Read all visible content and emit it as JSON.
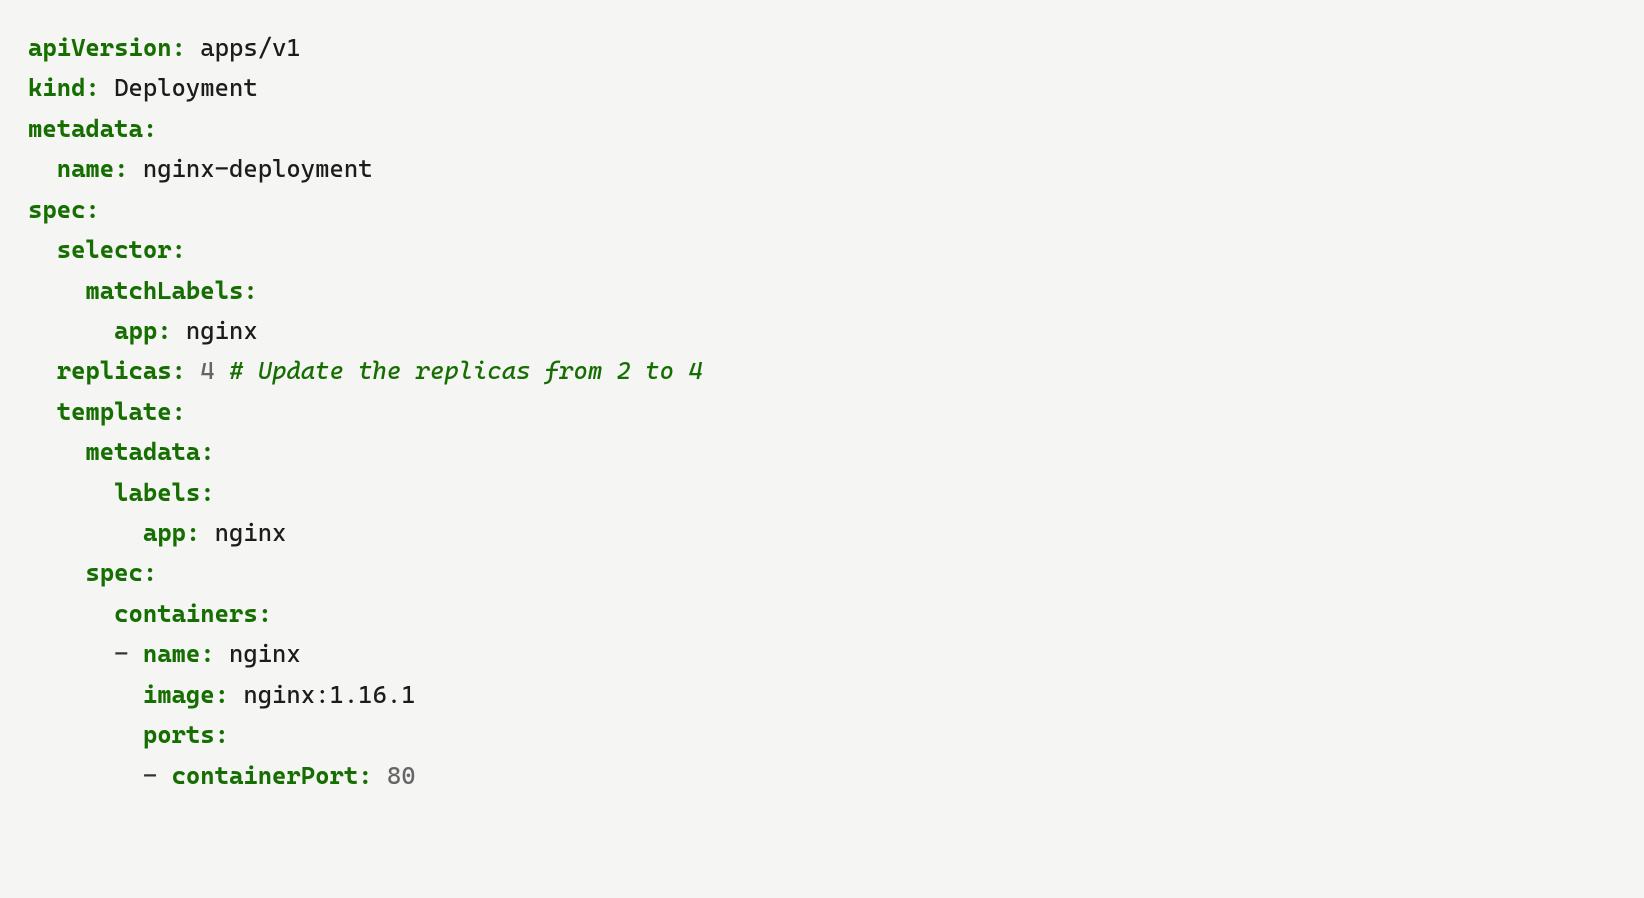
{
  "yaml": {
    "apiVersion_key": "apiVersion:",
    "apiVersion_val": " apps/v1",
    "kind_key": "kind:",
    "kind_val": " Deployment",
    "metadata_key": "metadata:",
    "metadata_name_key": "  name:",
    "metadata_name_val": " nginx-deployment",
    "spec_key": "spec:",
    "selector_key": "  selector:",
    "matchLabels_key": "    matchLabels:",
    "matchLabels_app_key": "      app:",
    "matchLabels_app_val": " nginx",
    "replicas_key": "  replicas:",
    "replicas_val": " 4 ",
    "replicas_comment": "# Update the replicas from 2 to 4",
    "template_key": "  template:",
    "tmpl_metadata_key": "    metadata:",
    "tmpl_labels_key": "      labels:",
    "tmpl_labels_app_key": "        app:",
    "tmpl_labels_app_val": " nginx",
    "tmpl_spec_key": "    spec:",
    "containers_key": "      containers:",
    "container_dash": "      - ",
    "container_name_key": "name:",
    "container_name_val": " nginx",
    "container_image_indent": "        ",
    "container_image_key": "image:",
    "container_image_val": " nginx:1.16.1",
    "container_ports_indent": "        ",
    "container_ports_key": "ports:",
    "port_dash": "        - ",
    "containerPort_key": "containerPort:",
    "containerPort_val": " 80"
  }
}
